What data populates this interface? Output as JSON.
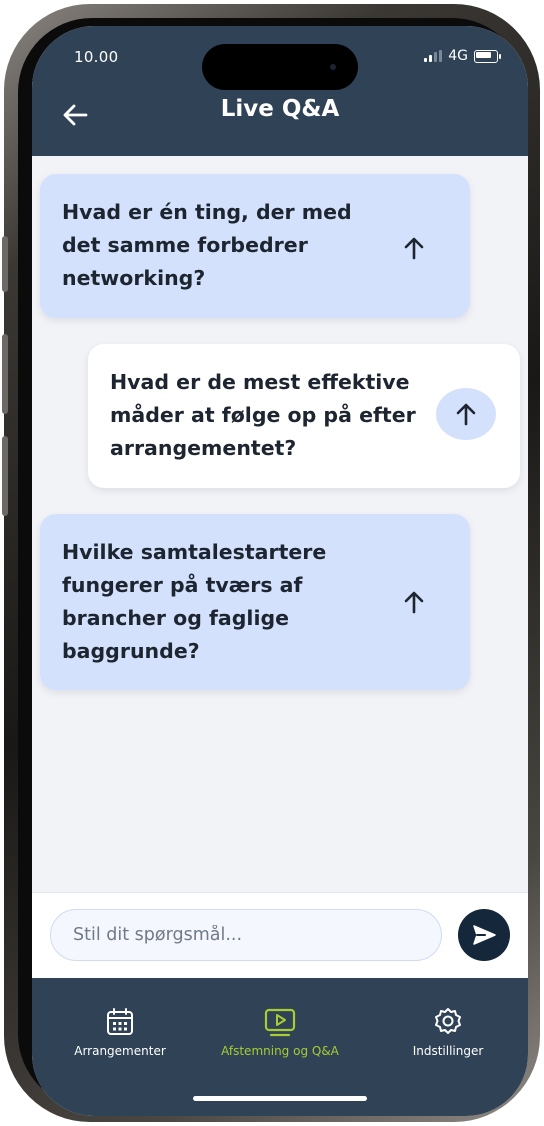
{
  "status_bar": {
    "time": "10.00",
    "network": "4G"
  },
  "header": {
    "title": "Live Q&A",
    "back_icon": "arrow-left-icon"
  },
  "questions": [
    {
      "text": "Hvad er én ting, der med\ndet samme forbedrer\nnetworking?",
      "style": "blue",
      "upvote_icon": "arrow-up-icon"
    },
    {
      "text": "Hvad er de mest effektive\nmåder at følge op på efter\narrangementet?",
      "style": "white",
      "upvote_icon": "arrow-up-icon"
    },
    {
      "text": "Hvilke samtalestartere\nfungerer på tværs af\nbrancher og faglige\nbaggrunde?",
      "style": "blue",
      "upvote_icon": "arrow-up-icon"
    }
  ],
  "composer": {
    "placeholder": "Stil dit spørgsmål...",
    "value": "",
    "send_icon": "send-icon"
  },
  "nav": {
    "items": [
      {
        "label": "Arrangementer",
        "icon": "calendar-icon",
        "active": false
      },
      {
        "label": "Afstemning og Q&A",
        "icon": "play-screen-icon",
        "active": true
      },
      {
        "label": "Indstillinger",
        "icon": "gear-icon",
        "active": false
      }
    ]
  },
  "colors": {
    "header_bg": "#2f4256",
    "card_blue": "#d4e1fc",
    "active_nav": "#a7cc34",
    "send_button": "#15273a"
  }
}
